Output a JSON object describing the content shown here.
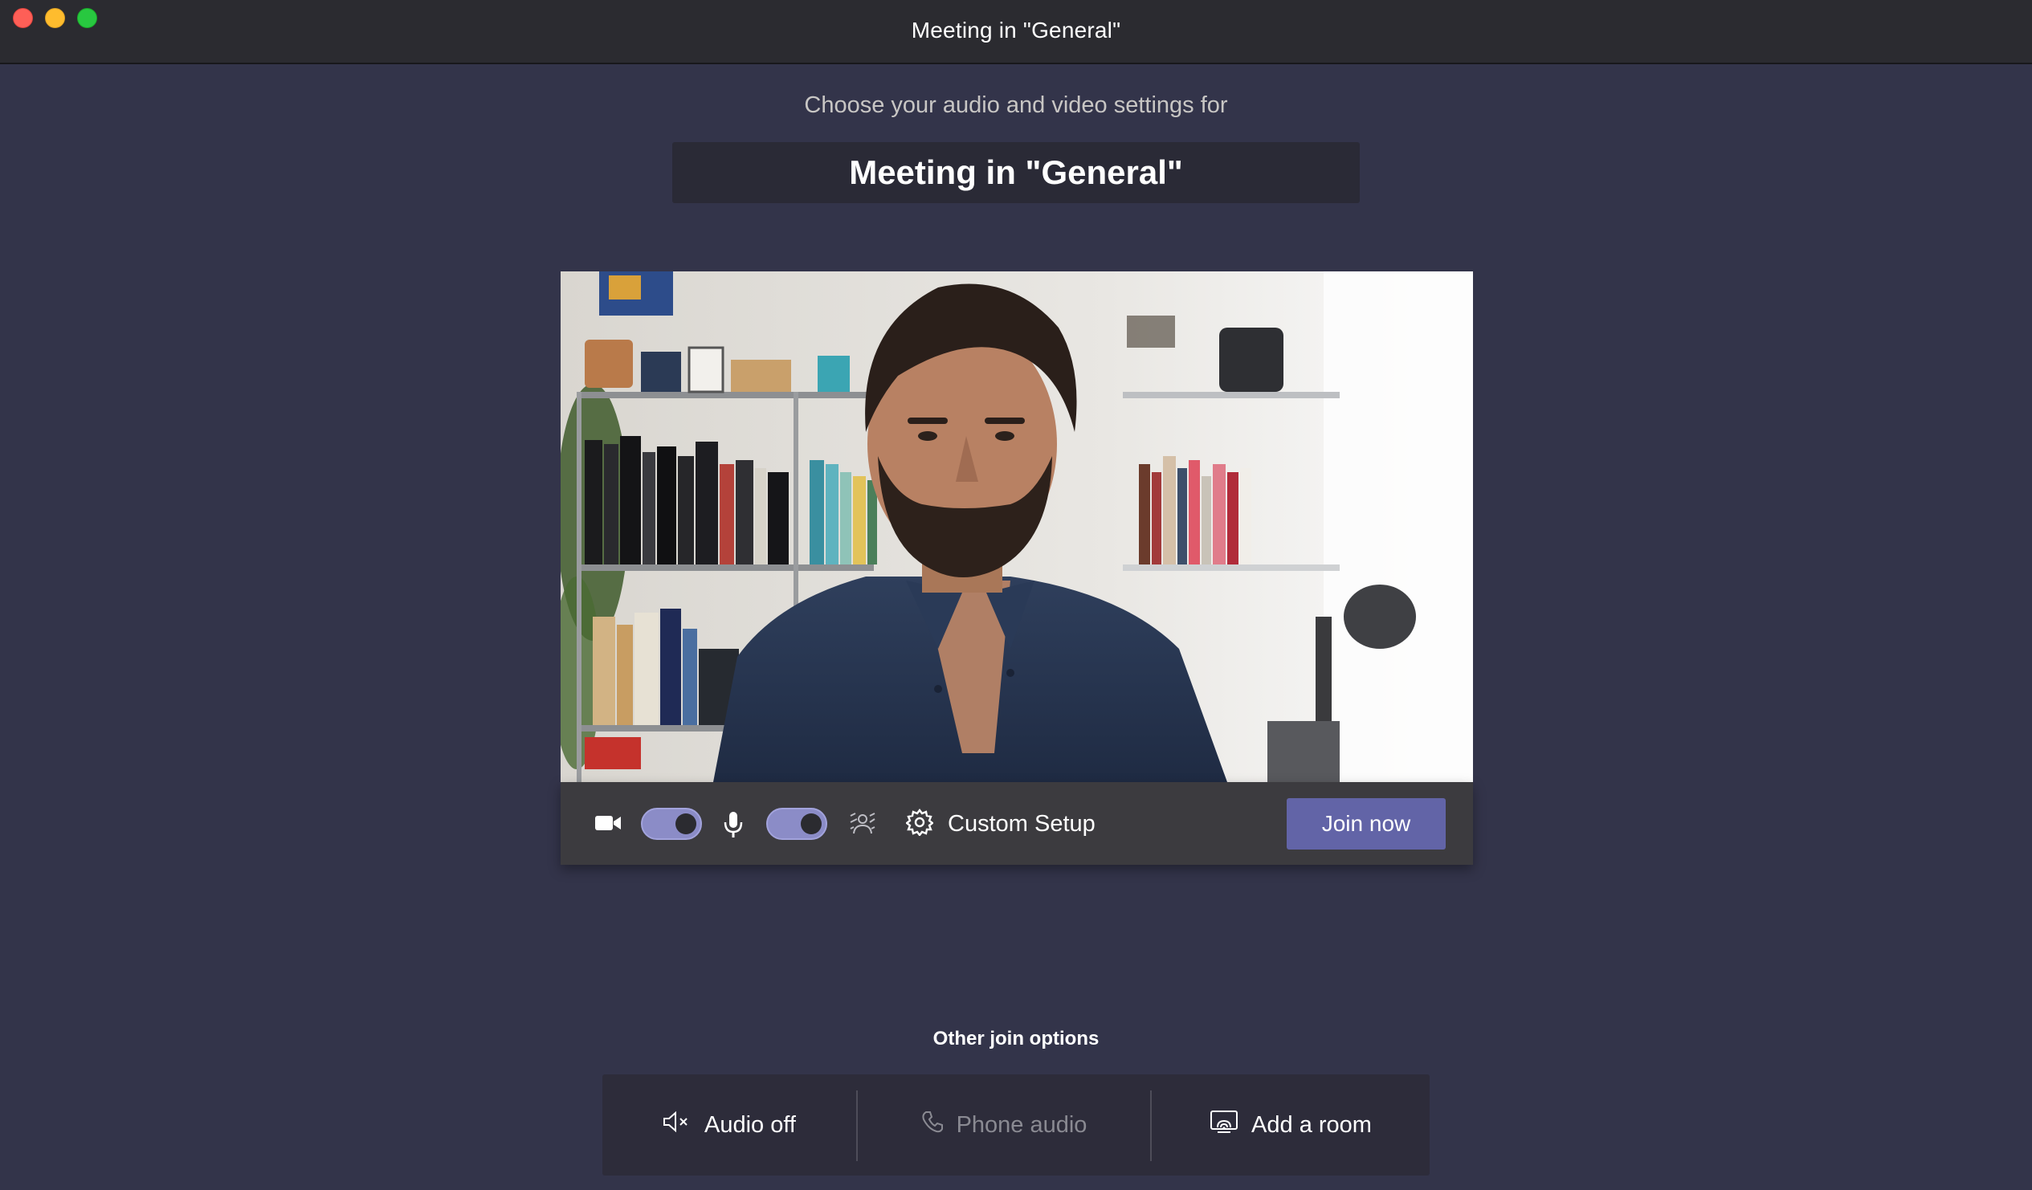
{
  "window": {
    "title": "Meeting in \"General\""
  },
  "heading": {
    "subtitle": "Choose your audio and video settings for",
    "meeting_name": "Meeting in \"General\""
  },
  "controls": {
    "camera_icon": "video-camera-icon",
    "camera_on": true,
    "mic_icon": "microphone-icon",
    "mic_on": true,
    "blur_icon": "background-blur-icon",
    "custom_setup_icon": "gear-icon",
    "custom_setup_label": "Custom Setup",
    "join_label": "Join now"
  },
  "other_options": {
    "title": "Other join options",
    "items": [
      {
        "label": "Audio off",
        "icon": "speaker-muted-icon",
        "enabled": true
      },
      {
        "label": "Phone audio",
        "icon": "phone-icon",
        "enabled": false
      },
      {
        "label": "Add a room",
        "icon": "cast-room-icon",
        "enabled": true
      }
    ]
  },
  "colors": {
    "background": "#33344a",
    "accent": "#6264a7",
    "toggle_on": "#8b8cc7",
    "control_bar": "#3c3b3f"
  }
}
